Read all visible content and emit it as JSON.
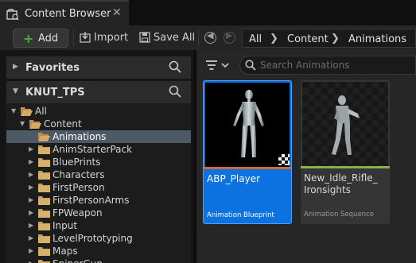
{
  "tab": {
    "title": "Content Browser",
    "icon": "content-browser-icon",
    "close": "✕"
  },
  "toolbar": {
    "add_label": "Add",
    "import_label": "Import",
    "save_all_label": "Save All"
  },
  "breadcrumb": [
    "All",
    "Content",
    "Animations"
  ],
  "sections": {
    "favorites": "Favorites",
    "project": "KNUT_TPS"
  },
  "tree": [
    {
      "label": "All",
      "expanded": true
    },
    {
      "label": "Content",
      "expanded": true
    },
    {
      "label": "Animations",
      "selected": true
    },
    {
      "label": "AnimStarterPack"
    },
    {
      "label": "BluePrints"
    },
    {
      "label": "Characters"
    },
    {
      "label": "FirstPerson"
    },
    {
      "label": "FirstPersonArms"
    },
    {
      "label": "FPWeapon"
    },
    {
      "label": "Input"
    },
    {
      "label": "LevelPrototyping"
    },
    {
      "label": "Maps"
    },
    {
      "label": "SniperGun"
    }
  ],
  "search": {
    "placeholder": "Search Animations",
    "value": ""
  },
  "assets": [
    {
      "name": "ABP_Player",
      "type": "Animation Blueprint",
      "selected": true,
      "color": "#d26a2e"
    },
    {
      "name": "New_Idle_Rifle_\nIronsights",
      "type": "Animation Sequence",
      "selected": false,
      "color": "#88b14a"
    }
  ],
  "colors": {
    "accent": "#0c72e0",
    "add_green": "#4caf3a",
    "folder": "#c8a060"
  }
}
